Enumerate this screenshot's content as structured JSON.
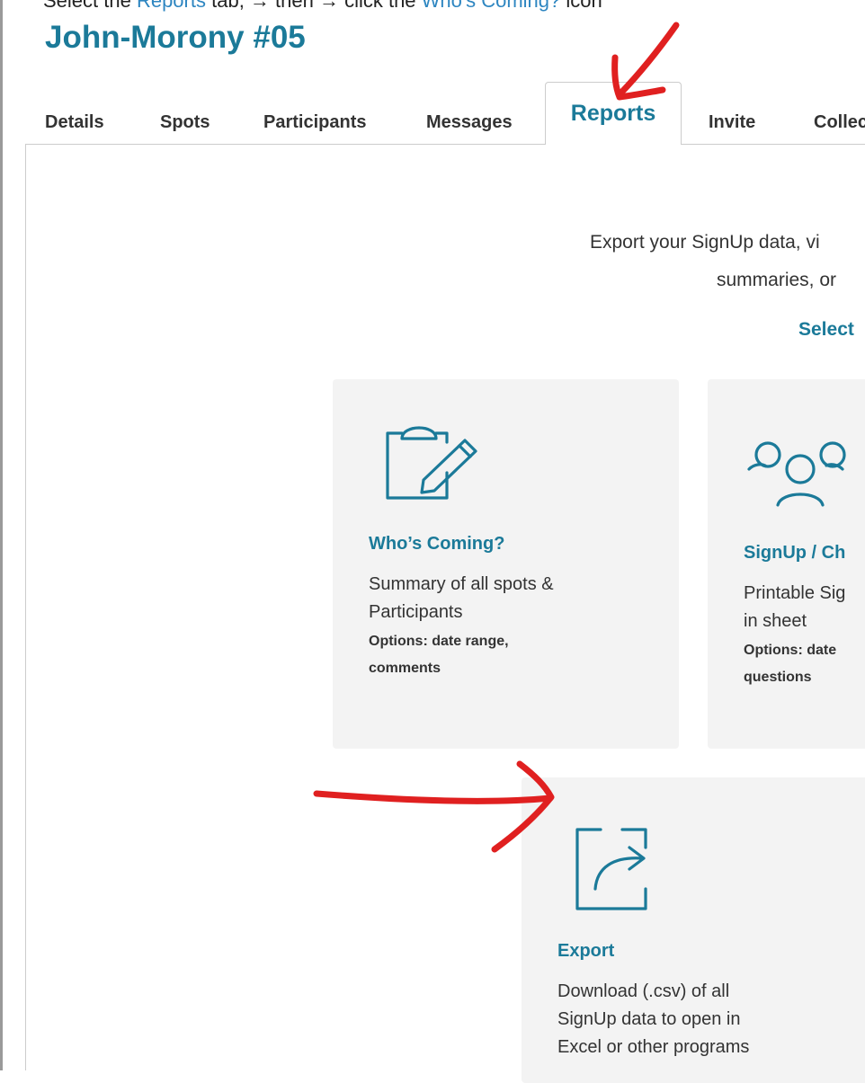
{
  "instruction": {
    "prefix": "Select the ",
    "tab_link": "Reports",
    "middle": " tab, → then → click the ",
    "icon_link": "Who's Coming?",
    "suffix": " icon"
  },
  "signup": {
    "title": "John-Morony #05"
  },
  "tabs": [
    {
      "label": "Details"
    },
    {
      "label": "Spots"
    },
    {
      "label": "Participants"
    },
    {
      "label": "Messages"
    },
    {
      "label": "Reports"
    },
    {
      "label": "Invite"
    },
    {
      "label": "Collect"
    }
  ],
  "intro": {
    "line1": "Export your SignUp data, vi",
    "line2": "summaries, or",
    "select_label": "Select"
  },
  "cards": {
    "who": {
      "icon": "clipboard-edit-icon",
      "title": "Who’s Coming?",
      "desc_line1": "Summary of all spots &",
      "desc_line2": "Participants",
      "opt_line1": "Options: date range,",
      "opt_line2": "comments"
    },
    "signup": {
      "icon": "people-group-icon",
      "title": "SignUp / Ch",
      "desc_line1": "Printable Sig",
      "desc_line2": "in sheet",
      "opt_line1": "Options: date",
      "opt_line2": "questions"
    },
    "export": {
      "icon": "export-share-icon",
      "title": "Export",
      "desc_line1": "Download (.csv) of all",
      "desc_line2": "SignUp data to open in",
      "desc_line3": "Excel or other programs"
    }
  },
  "colors": {
    "brand": "#1b7a99",
    "annotation": "#e02020",
    "card_bg": "#f3f3f3"
  }
}
